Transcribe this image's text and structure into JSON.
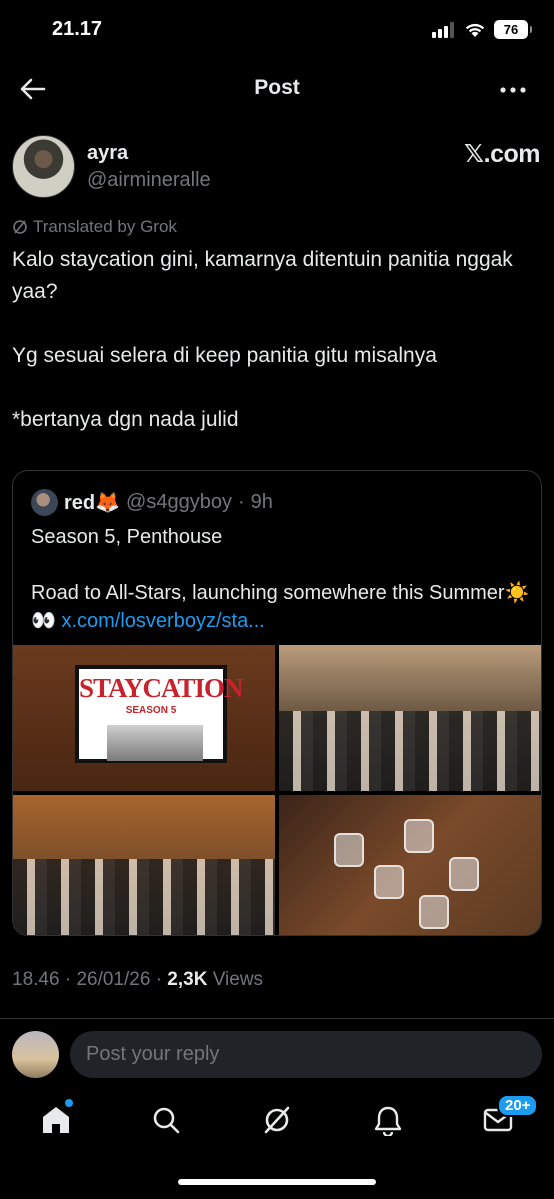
{
  "status_bar": {
    "time": "21.17",
    "battery": "76"
  },
  "topbar": {
    "title": "Post"
  },
  "author": {
    "name": "ayra",
    "handle": "@airmineralle"
  },
  "branding": {
    "xcom": "𝕏.com"
  },
  "translation": {
    "label": "Translated by Grok"
  },
  "post": {
    "paragraphs": [
      "Kalo staycation gini, kamarnya ditentuin panitia nggak yaa?",
      "Yg sesuai selera di keep panitia gitu misalnya",
      "*bertanya dgn nada julid"
    ],
    "time": "18.46",
    "date": "26/01/26",
    "views_count": "2,3K",
    "views_label": "Views"
  },
  "quote": {
    "name": "red🦊",
    "handle": "@s4ggyboy",
    "age": "9h",
    "line1": "Season 5, Penthouse",
    "line2_text": "Road to All-Stars, launching somewhere this Summer☀️👀",
    "link": "x.com/losverboyz/sta...",
    "tv_title": "STAYCATION",
    "tv_sub": "SEASON 5"
  },
  "reply": {
    "placeholder": "Post your reply"
  },
  "tabs": {
    "messages_badge": "20+"
  },
  "colors": {
    "accent": "#1d9bf0",
    "muted": "#71767b",
    "text": "#e7e9ea",
    "background": "#000000"
  }
}
